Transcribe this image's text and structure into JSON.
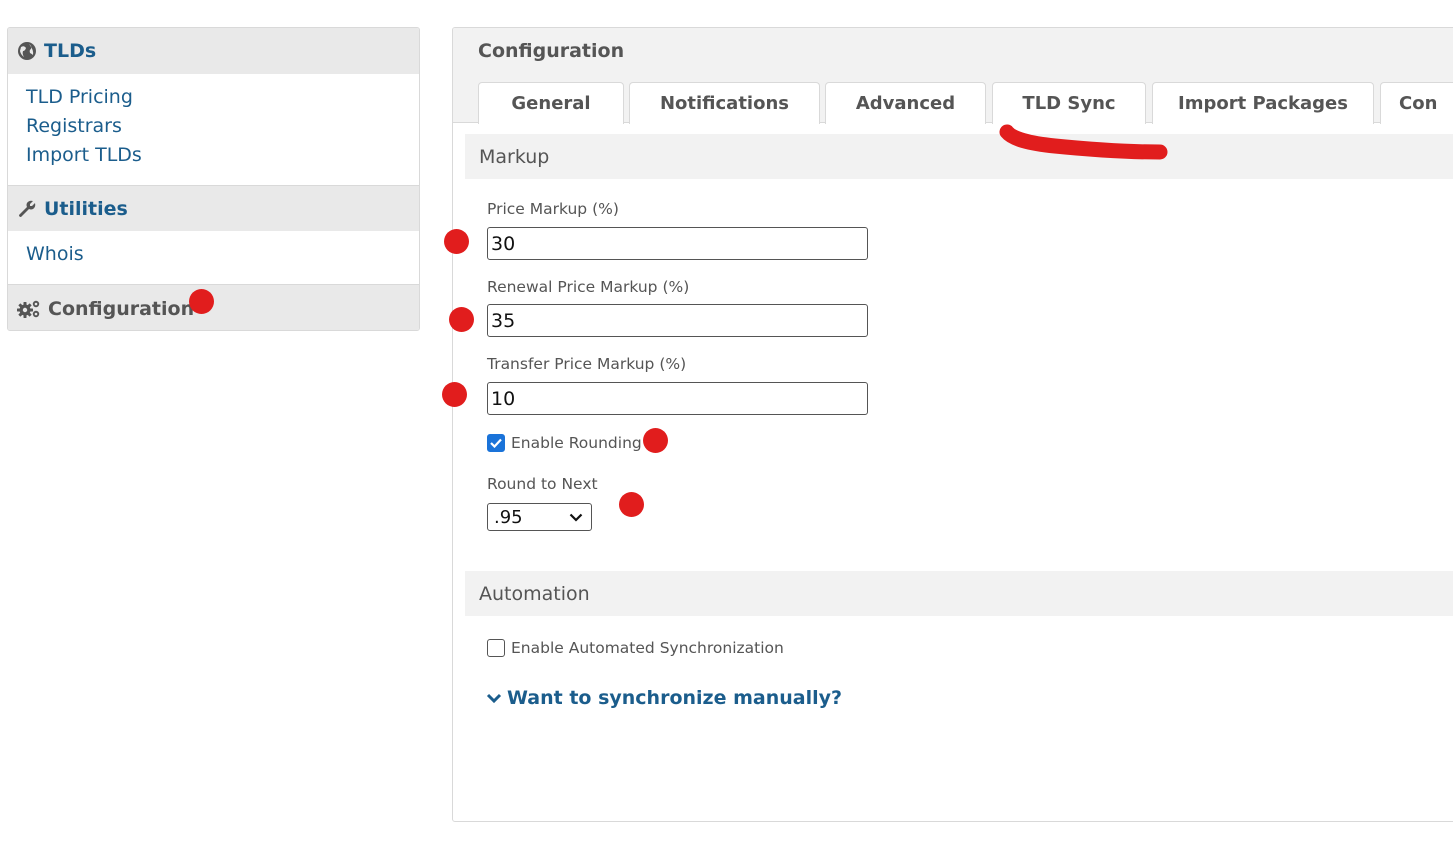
{
  "sidebar": {
    "sections": [
      {
        "title": "TLDs",
        "icon": "globe-icon",
        "items": [
          "TLD Pricing",
          "Registrars",
          "Import TLDs"
        ]
      },
      {
        "title": "Utilities",
        "icon": "wrench-icon",
        "items": [
          "Whois"
        ]
      },
      {
        "title": "Configuration",
        "icon": "gears-icon",
        "items": []
      }
    ]
  },
  "main": {
    "title": "Configuration",
    "tabs": [
      "General",
      "Notifications",
      "Advanced",
      "TLD Sync",
      "Import Packages",
      "Con"
    ],
    "markup": {
      "heading": "Markup",
      "price_markup_label": "Price Markup (%)",
      "price_markup_value": "30",
      "renewal_markup_label": "Renewal Price Markup (%)",
      "renewal_markup_value": "35",
      "transfer_markup_label": "Transfer Price Markup (%)",
      "transfer_markup_value": "10",
      "enable_rounding_label": "Enable Rounding",
      "enable_rounding_checked": true,
      "round_to_next_label": "Round to Next",
      "round_to_next_value": ".95"
    },
    "automation": {
      "heading": "Automation",
      "enable_sync_label": "Enable Automated Synchronization",
      "enable_sync_checked": false,
      "manual_sync_link": "Want to synchronize manually?"
    }
  },
  "colors": {
    "link_blue": "#1b5d8c",
    "annotation_red": "#e11d1d",
    "checkbox_blue": "#1a73d9"
  }
}
